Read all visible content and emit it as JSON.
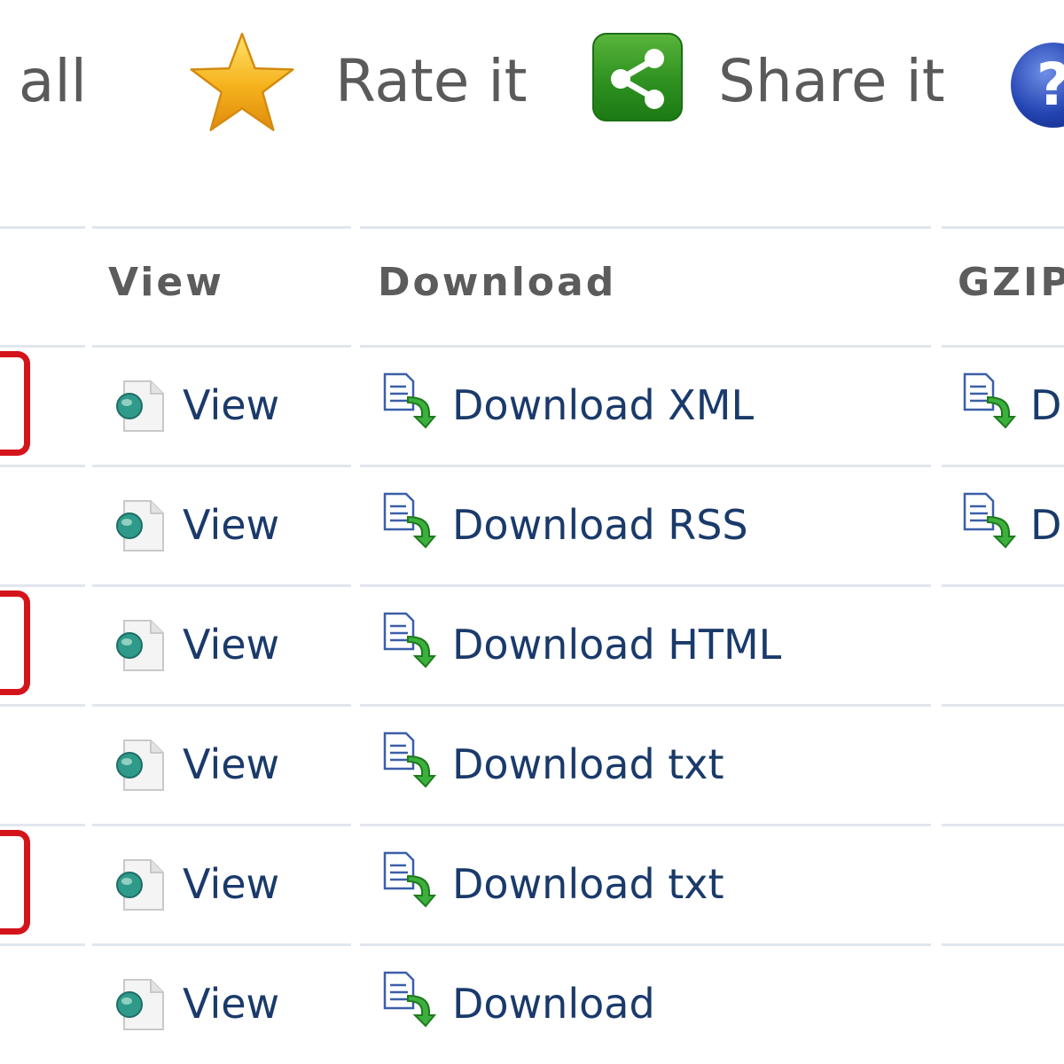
{
  "toolbar": {
    "download_all_label": "d all",
    "rate_label": "Rate it",
    "share_label": "Share it",
    "help_symbol": "?",
    "icons": [
      "star-icon",
      "share-icon",
      "help-icon"
    ]
  },
  "table": {
    "headers": {
      "view": "View",
      "download": "Download",
      "gzip": "GZIP"
    },
    "rows": [
      {
        "view": "View",
        "download": "Download XML",
        "gzip": "D",
        "marked": true
      },
      {
        "view": "View",
        "download": "Download RSS",
        "gzip": "D",
        "marked": false
      },
      {
        "view": "View",
        "download": "Download HTML",
        "gzip": "",
        "marked": true
      },
      {
        "view": "View",
        "download": "Download txt",
        "gzip": "",
        "marked": false
      },
      {
        "view": "View",
        "download": "Download txt",
        "gzip": "",
        "marked": true
      },
      {
        "view": "View",
        "download": "Download",
        "gzip": "",
        "marked": false
      }
    ]
  },
  "colors": {
    "link": "#1a3a6b",
    "header_text": "#5c5c5c",
    "marker_red": "#d3151b",
    "share_green": "#2e9120",
    "star_gold": "#f5b21c"
  }
}
